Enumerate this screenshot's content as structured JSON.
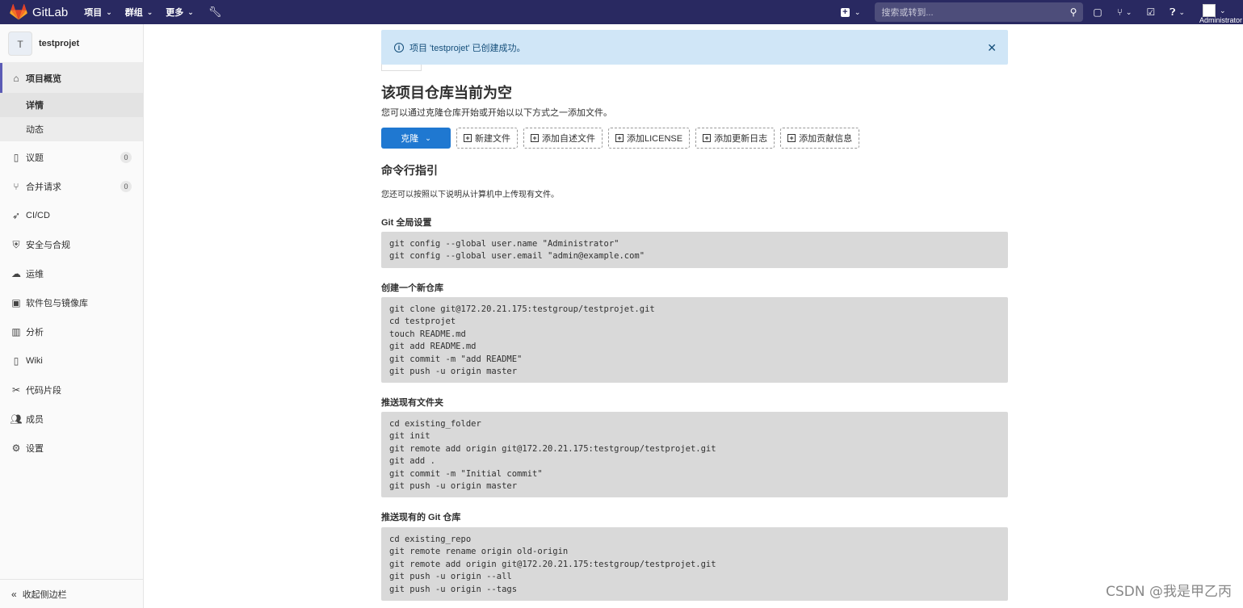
{
  "topbar": {
    "brand": "GitLab",
    "nav": [
      {
        "label": "项目"
      },
      {
        "label": "群组"
      },
      {
        "label": "更多"
      }
    ],
    "search_placeholder": "搜索或转到...",
    "user_name": "Administrator"
  },
  "sidebar": {
    "project_initial": "T",
    "project_name": "testprojet",
    "overview_label": "项目概览",
    "overview_sub": [
      {
        "label": "详情"
      },
      {
        "label": "动态"
      }
    ],
    "items": [
      {
        "label": "议题",
        "badge": "0",
        "icon": "issues-icon"
      },
      {
        "label": "合并请求",
        "badge": "0",
        "icon": "merge-request-icon"
      },
      {
        "label": "CI/CD",
        "icon": "rocket-icon"
      },
      {
        "label": "安全与合规",
        "icon": "shield-icon"
      },
      {
        "label": "运维",
        "icon": "cloud-icon"
      },
      {
        "label": "软件包与镜像库",
        "icon": "package-icon"
      },
      {
        "label": "分析",
        "icon": "chart-icon"
      },
      {
        "label": "Wiki",
        "icon": "book-icon"
      },
      {
        "label": "代码片段",
        "icon": "scissors-icon"
      },
      {
        "label": "成员",
        "icon": "users-icon"
      },
      {
        "label": "设置",
        "icon": "gear-icon"
      }
    ],
    "collapse_label": "收起侧边栏"
  },
  "flash": {
    "message": "项目 'testprojet' 已创建成功。"
  },
  "main": {
    "empty_title": "该项目仓库当前为空",
    "empty_desc": "您可以通过克隆仓库开始或开始以以下方式之一添加文件。",
    "clone_label": "克隆",
    "buttons": [
      {
        "label": "新建文件"
      },
      {
        "label": "添加自述文件"
      },
      {
        "label": "添加LICENSE"
      },
      {
        "label": "添加更新日志"
      },
      {
        "label": "添加贡献信息"
      }
    ],
    "cli_title": "命令行指引",
    "cli_desc": "您还可以按照以下说明从计算机中上传现有文件。",
    "sections": [
      {
        "title": "Git 全局设置",
        "code": "git config --global user.name \"Administrator\"\ngit config --global user.email \"admin@example.com\""
      },
      {
        "title": "创建一个新仓库",
        "code": "git clone git@172.20.21.175:testgroup/testprojet.git\ncd testprojet\ntouch README.md\ngit add README.md\ngit commit -m \"add README\"\ngit push -u origin master"
      },
      {
        "title": "推送现有文件夹",
        "code": "cd existing_folder\ngit init\ngit remote add origin git@172.20.21.175:testgroup/testprojet.git\ngit add .\ngit commit -m \"Initial commit\"\ngit push -u origin master"
      },
      {
        "title": "推送现有的 Git 仓库",
        "code": "cd existing_repo\ngit remote rename origin old-origin\ngit remote add origin git@172.20.21.175:testgroup/testprojet.git\ngit push -u origin --all\ngit push -u origin --tags"
      }
    ]
  },
  "watermark": "CSDN @我是甲乙丙",
  "colors": {
    "topbar": "#292961",
    "primary_button": "#1f78d1",
    "flash_bg": "#d0e6f7",
    "code_bg": "#d9d9d9"
  }
}
